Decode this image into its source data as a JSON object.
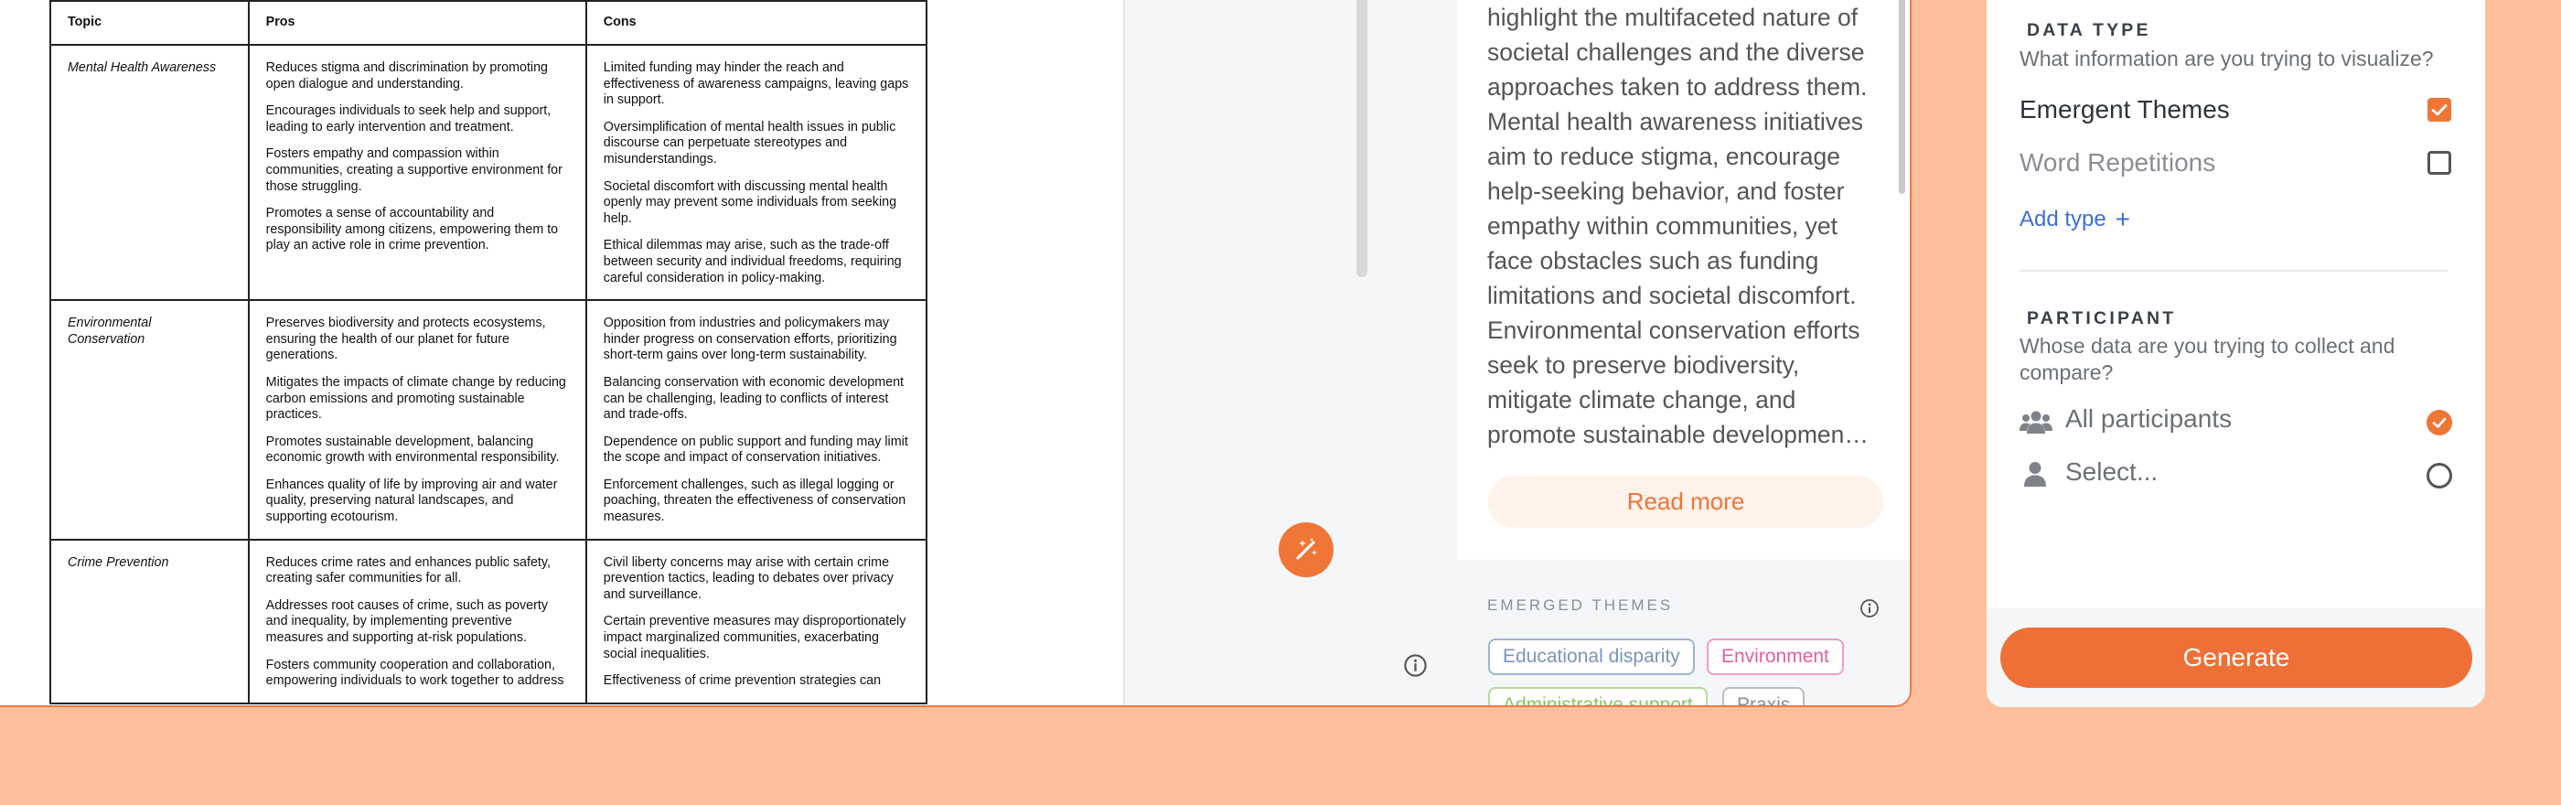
{
  "document": {
    "headers": {
      "topic": "Topic",
      "pros": "Pros",
      "cons": "Cons"
    },
    "rows": [
      {
        "topic": "Mental Health Awareness",
        "pros": [
          "Reduces stigma and discrimination by promoting open dialogue and understanding.",
          "Encourages individuals to seek help and support, leading to early intervention and treatment.",
          "Fosters empathy and compassion within communities, creating a supportive environment for those struggling.",
          "Promotes a sense of accountability and responsibility among citizens, empowering them to play an active role in crime prevention."
        ],
        "cons": [
          "Limited funding may hinder the reach and effectiveness of awareness campaigns, leaving gaps in support.",
          "Oversimplification of mental health issues in public discourse can perpetuate stereotypes and misunderstandings.",
          "Societal discomfort with discussing mental health openly may prevent some individuals from seeking help.",
          "Ethical dilemmas may arise, such as the trade-off between security and individual freedoms, requiring careful consideration in policy-making."
        ]
      },
      {
        "topic": "Environmental Conservation",
        "pros": [
          "Preserves biodiversity and protects ecosystems, ensuring the health of our planet for future generations.",
          "Mitigates the impacts of climate change by reducing carbon emissions and promoting sustainable practices.",
          "Promotes sustainable development, balancing economic growth with environmental responsibility.",
          "Enhances quality of life by improving air and water quality, preserving natural landscapes, and supporting ecotourism."
        ],
        "cons": [
          "Opposition from industries and policymakers may hinder progress on conservation efforts, prioritizing short-term gains over long-term sustainability.",
          "Balancing conservation with economic development can be challenging, leading to conflicts of interest and trade-offs.",
          "Dependence on public support and funding may limit the scope and impact of conservation initiatives.",
          "Enforcement challenges, such as illegal logging or poaching, threaten the effectiveness of conservation measures."
        ]
      },
      {
        "topic": "Crime Prevention",
        "pros": [
          "Reduces crime rates and enhances public safety, creating safer communities for all.",
          "Addresses root causes of crime, such as poverty and inequality, by implementing preventive measures and supporting at-risk populations.",
          "Fosters community cooperation and collaboration, empowering individuals to work together to address"
        ],
        "cons": [
          "Civil liberty concerns may arise with certain crime prevention tactics, leading to debates over privacy and surveillance.",
          "Certain preventive measures may disproportionately impact marginalized communities, exacerbating social inequalities.",
          "Effectiveness of crime prevention strategies can"
        ]
      }
    ]
  },
  "summary": {
    "lines": [
      "highlight the multifaceted nature of",
      "societal challenges and the diverse",
      "approaches taken to address them.",
      "Mental health awareness initiatives",
      "aim to reduce stigma, encourage",
      "help-seeking behavior, and foster",
      "empathy within communities, yet",
      "face obstacles such as funding",
      "limitations and societal discomfort.",
      "Environmental conservation efforts",
      "seek to preserve biodiversity,",
      "mitigate climate change, and",
      "promote sustainable developmen…"
    ],
    "read_more_label": "Read more",
    "themes_title": "EMERGED THEMES",
    "themes": [
      {
        "label": "Educational disparity",
        "color": "#7c94b8",
        "border": "#9fb4d3"
      },
      {
        "label": "Environment",
        "color": "#e0609e",
        "border": "#f09cc4"
      },
      {
        "label": "Administrative support",
        "color": "#8cc06a",
        "border": "#b5db9c"
      },
      {
        "label": "Praxis",
        "color": "#8a8f96",
        "border": "#b9bdc3"
      }
    ]
  },
  "settings": {
    "data_type": {
      "title": "DATA TYPE",
      "hint": "What information are you trying to visualize?",
      "options": [
        {
          "label": "Emergent Themes",
          "checked": true
        },
        {
          "label": "Word Repetitions",
          "checked": false
        }
      ],
      "add_label": "Add type",
      "add_symbol": "+"
    },
    "participant": {
      "title": "PARTICIPANT",
      "hint_line1": "Whose data are you trying to collect and",
      "hint_line2": "compare?",
      "options": [
        {
          "label": "All participants",
          "icon": "group-icon",
          "checked": true
        },
        {
          "label": "Select...",
          "icon": "person-icon",
          "checked": false
        }
      ]
    },
    "generate_label": "Generate"
  },
  "colors": {
    "background": "#fdbf9c",
    "accent": "#ef7636",
    "link": "#3d6fd6"
  }
}
